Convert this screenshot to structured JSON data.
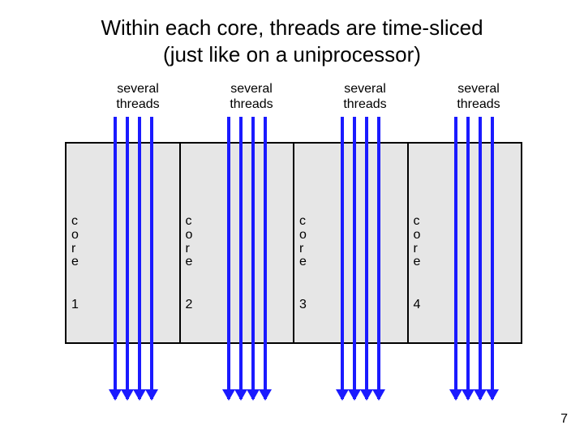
{
  "title_line1": "Within each core, threads are time-sliced",
  "title_line2": "(just like on a uniprocessor)",
  "thread_label_1": "several",
  "thread_label_2": "threads",
  "core_word_c": "c",
  "core_word_o": "o",
  "core_word_r": "r",
  "core_word_e": "e",
  "cores": {
    "1": "1",
    "2": "2",
    "3": "3",
    "4": "4"
  },
  "page_number": "7"
}
